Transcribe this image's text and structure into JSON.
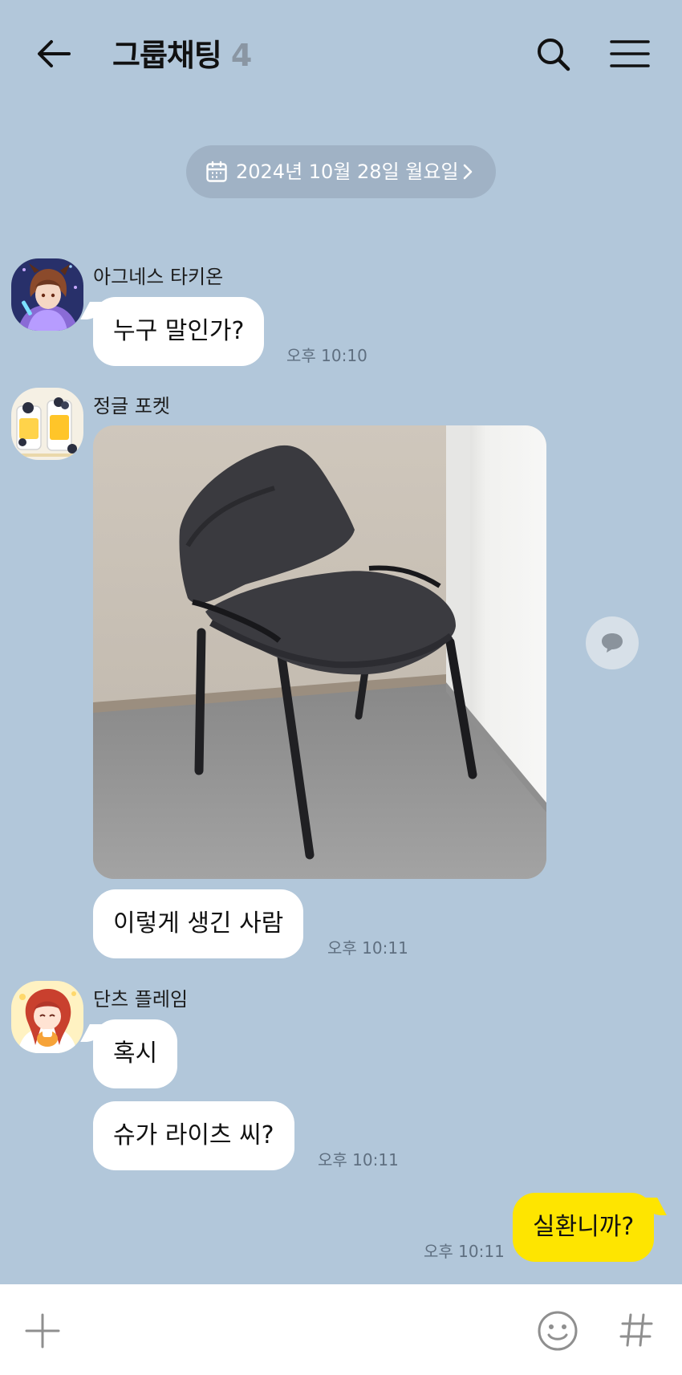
{
  "header": {
    "title": "그룹채팅",
    "member_count": "4"
  },
  "date_divider": {
    "label": "2024년 10월 28일 월요일"
  },
  "messages": [
    {
      "sender": "아그네스 타키온",
      "bubbles": [
        "누구 말인가?"
      ],
      "time": "오후 10:10"
    },
    {
      "sender": "정글 포켓",
      "image": "chair-photo",
      "bubbles": [
        "이렇게 생긴 사람"
      ],
      "time": "오후 10:11"
    },
    {
      "sender": "단츠 플레임",
      "bubbles": [
        "혹시",
        "슈가 라이츠 씨?"
      ],
      "time": "오후 10:11"
    },
    {
      "sender": "me",
      "bubbles": [
        "실환니까?"
      ],
      "time": "오후 10:11"
    }
  ],
  "icons": {
    "back": "back-arrow-icon",
    "search": "search-icon",
    "menu": "hamburger-menu-icon",
    "calendar": "calendar-icon",
    "reply": "reply-bubble-icon",
    "plus": "plus-icon",
    "emoji": "emoji-icon",
    "hashtag": "hashtag-icon"
  },
  "colors": {
    "background": "#b2c7da",
    "my_bubble": "#fee500",
    "other_bubble": "#ffffff",
    "input_bar": "#ffffff"
  }
}
